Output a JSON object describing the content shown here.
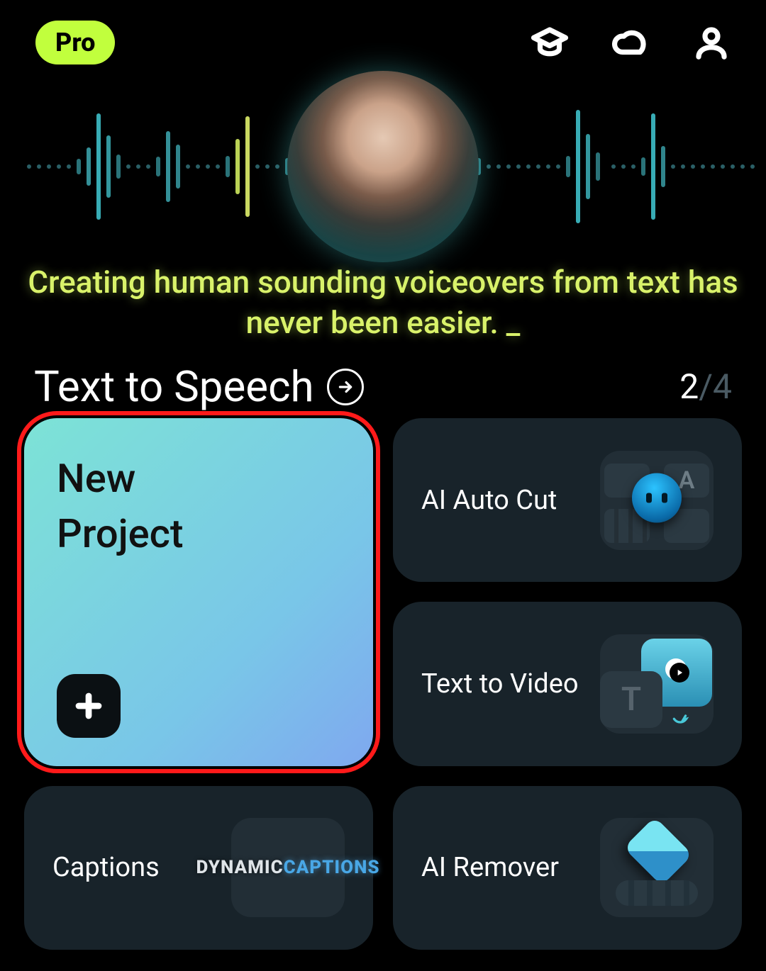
{
  "header": {
    "badge": "Pro"
  },
  "hero": {
    "tagline": "Creating human sounding voiceovers from text has never been easier. _"
  },
  "feature": {
    "title": "Text to Speech",
    "pager_current": "2",
    "pager_sep": "/",
    "pager_total": "4"
  },
  "cards": {
    "new_project": "New Project",
    "ai_auto_cut": "AI Auto Cut",
    "text_to_video": "Text to Video",
    "captions": "Captions",
    "captions_thumb_line1": "DYNAMIC",
    "captions_thumb_line2": "CAPTIONS",
    "ai_remover": "AI Remover",
    "ttv_T": "T",
    "aac_A": "A"
  }
}
